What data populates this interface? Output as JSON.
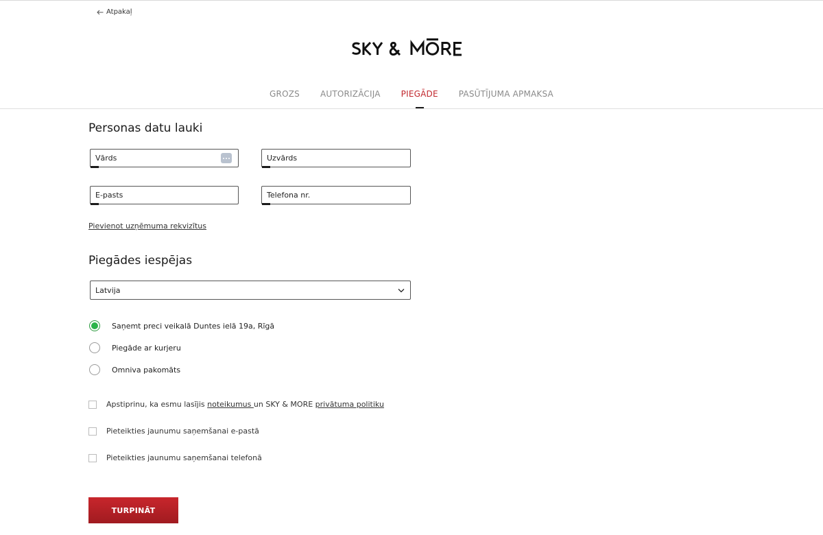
{
  "header": {
    "back_label": "Atpakaļ",
    "brand": "SKY & MORE"
  },
  "steps": [
    {
      "label": "GROZS",
      "active": false
    },
    {
      "label": "AUTORIZĀCIJA",
      "active": false
    },
    {
      "label": "PIEGĀDE",
      "active": true
    },
    {
      "label": "PASŪTĪJUMA APMAKSA",
      "active": false
    }
  ],
  "personal": {
    "title": "Personas datu lauki",
    "first_name_placeholder": "Vārds",
    "last_name_placeholder": "Uzvārds",
    "email_placeholder": "E-pasts",
    "phone_placeholder": "Telefona nr.",
    "company_link": "Pievienot uzņēmuma rekvizītus"
  },
  "delivery": {
    "title": "Piegādes iespējas",
    "country_selected": "Latvija",
    "options": [
      {
        "label": "Saņemt preci veikalā Duntes ielā 19a, Rīgā",
        "selected": true
      },
      {
        "label": "Piegāde ar kurjeru",
        "selected": false
      },
      {
        "label": "Omniva pakomāts",
        "selected": false
      }
    ]
  },
  "consents": {
    "terms_prefix": "Apstiprinu, ka esmu lasījis ",
    "terms_link": "noteikumus ",
    "terms_middle": "un SKY & MORE ",
    "privacy_link": "privātuma politiku",
    "newsletter_email": "Pieteikties jaunumu saņemšanai e-pastā",
    "newsletter_phone": "Pieteikties jaunumu saņemšanai telefonā"
  },
  "actions": {
    "continue_label": "TURPINĀT"
  },
  "colors": {
    "accent_red": "#c1272d",
    "radio_green": "#2bb44a"
  }
}
